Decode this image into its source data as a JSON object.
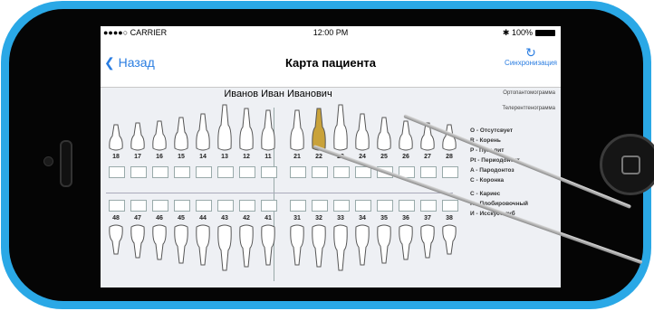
{
  "status_bar": {
    "carrier": "●●●●○ CARRIER",
    "time": "12:00 PM",
    "battery": "100%"
  },
  "nav": {
    "back_label": "Назад",
    "title": "Карта пациента",
    "sync_label": "Синхронизация"
  },
  "patient_name": "Иванов Иван Иванович",
  "side_menu": {
    "orthopantomogram": "Ортопантомограмма",
    "teleroentgenogram": "Телерентгенограмма"
  },
  "upper_teeth": [
    "18",
    "17",
    "16",
    "15",
    "14",
    "13",
    "12",
    "11",
    "21",
    "22",
    "23",
    "24",
    "25",
    "26",
    "27",
    "28"
  ],
  "lower_teeth": [
    "48",
    "47",
    "46",
    "45",
    "44",
    "43",
    "42",
    "41",
    "31",
    "32",
    "33",
    "34",
    "35",
    "36",
    "37",
    "38"
  ],
  "highlighted_tooth": "22",
  "highlight_color": "#c9a23a",
  "legend": [
    "O - Отсутсвует",
    "R - Корень",
    "P - Пульпит",
    "Pt - Периодонтит",
    "A - Пародонтоз",
    "C - Коронка",
    "С - Кариес",
    "П - Плобировочный",
    "И - Исскуст. зуб"
  ],
  "colors": {
    "accent": "#2a7de1",
    "device_frame": "#2aa8e6"
  }
}
